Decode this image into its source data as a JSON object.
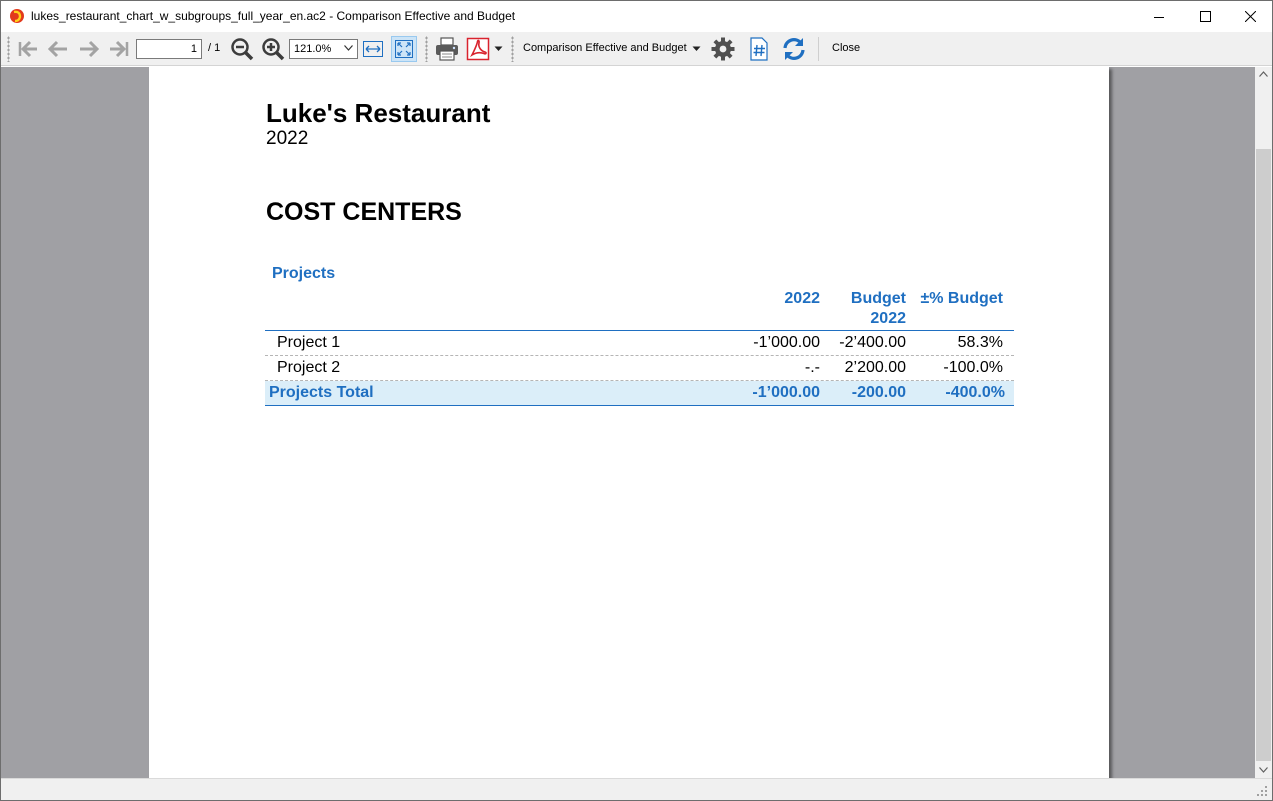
{
  "window": {
    "title": "lukes_restaurant_chart_w_subgroups_full_year_en.ac2 - Comparison Effective and Budget",
    "app_icon": "banana-logo-icon"
  },
  "toolbar": {
    "page_current": "1",
    "page_total": "/ 1",
    "zoom": "121.0%",
    "report_type": "Comparison Effective and Budget",
    "close_label": "Close"
  },
  "report": {
    "company": "Luke's Restaurant",
    "year": "2022",
    "section": "COST CENTERS",
    "group_title": "Projects",
    "columns": {
      "col1": "2022",
      "col2_line1": "Budget",
      "col2_line2": "2022",
      "col3": "±% Budget"
    },
    "rows": [
      {
        "label": "Project 1",
        "v2022": "-1’000.00",
        "budget": "-2’400.00",
        "pct": "58.3%"
      },
      {
        "label": "Project 2",
        "v2022": "-.-",
        "budget": "2’200.00",
        "pct": "-100.0%"
      }
    ],
    "total": {
      "label": "Projects Total",
      "v2022": "-1’000.00",
      "budget": "-200.00",
      "pct": "-400.0%"
    }
  },
  "colors": {
    "accent_blue": "#1f6fc1",
    "total_row_bg": "#dbeef9",
    "viewport_bg": "#a0a0a4"
  }
}
